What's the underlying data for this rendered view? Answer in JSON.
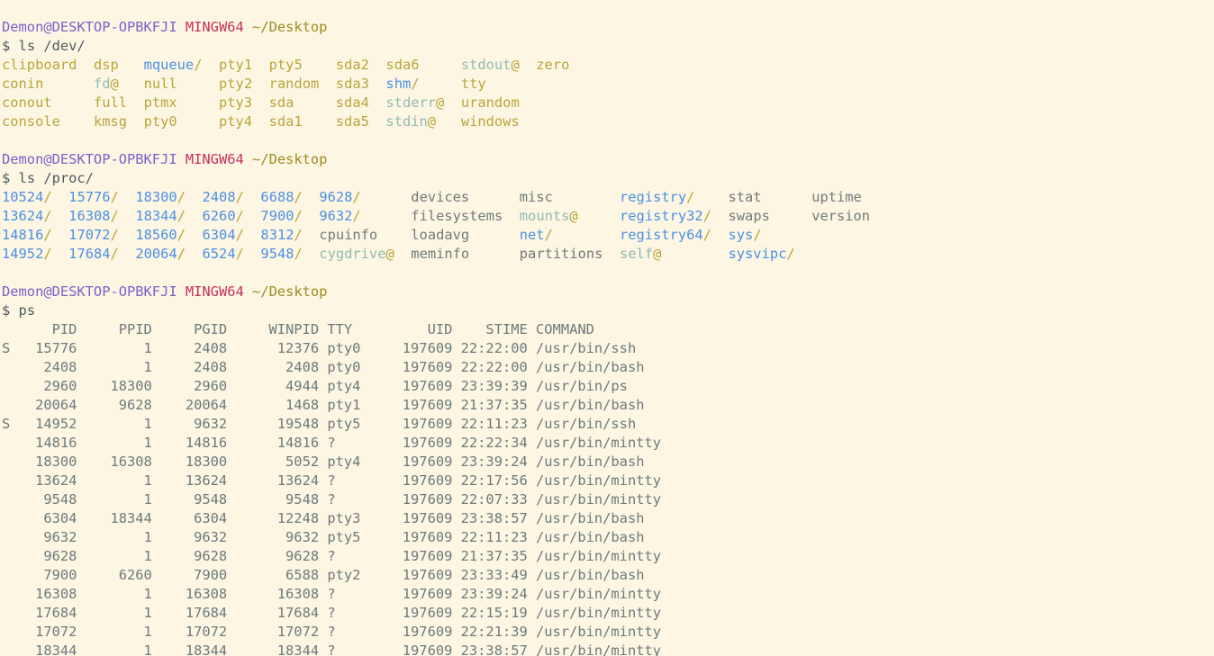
{
  "terminal": {
    "title": "MINGW64:/c/Users/Demon/Desktop",
    "shell": "MINGW64",
    "background_color": "#fdf6e3",
    "prompt": {
      "user_host": "Demon@DESKTOP-OPBKFJI",
      "env": "MINGW64",
      "cwd": "~/Desktop",
      "symbol": "$"
    },
    "colors": {
      "user_host": "#7d5fc9",
      "env": "#c7305c",
      "cwd": "#9c8c22",
      "command": "#4d5b60",
      "file": "#b9a53c",
      "directory": "#4d90e2",
      "symlink": "#92bab1",
      "plain": "#707a7a",
      "ps_output": "#6c7a7d"
    }
  },
  "blocks": [
    {
      "id": "ls-dev",
      "command": "ls /dev/",
      "rows": [
        [
          {
            "t": "clipboard",
            "k": "file"
          },
          {
            "t": "dsp",
            "k": "file"
          },
          {
            "t": "mqueue",
            "k": "dir"
          },
          {
            "t": "pty1",
            "k": "file"
          },
          {
            "t": "pty5",
            "k": "file"
          },
          {
            "t": "sda2",
            "k": "file"
          },
          {
            "t": "sda6",
            "k": "file"
          },
          {
            "t": "stdout",
            "k": "link"
          },
          {
            "t": "zero",
            "k": "file"
          }
        ],
        [
          {
            "t": "conin",
            "k": "file"
          },
          {
            "t": "fd",
            "k": "link"
          },
          {
            "t": "null",
            "k": "file"
          },
          {
            "t": "pty2",
            "k": "file"
          },
          {
            "t": "random",
            "k": "file"
          },
          {
            "t": "sda3",
            "k": "file"
          },
          {
            "t": "shm",
            "k": "dir"
          },
          {
            "t": "tty",
            "k": "file"
          }
        ],
        [
          {
            "t": "conout",
            "k": "file"
          },
          {
            "t": "full",
            "k": "file"
          },
          {
            "t": "ptmx",
            "k": "file"
          },
          {
            "t": "pty3",
            "k": "file"
          },
          {
            "t": "sda",
            "k": "file"
          },
          {
            "t": "sda4",
            "k": "file"
          },
          {
            "t": "stderr",
            "k": "link"
          },
          {
            "t": "urandom",
            "k": "file"
          }
        ],
        [
          {
            "t": "console",
            "k": "file"
          },
          {
            "t": "kmsg",
            "k": "file"
          },
          {
            "t": "pty0",
            "k": "file"
          },
          {
            "t": "pty4",
            "k": "file"
          },
          {
            "t": "sda1",
            "k": "file"
          },
          {
            "t": "sda5",
            "k": "file"
          },
          {
            "t": "stdin",
            "k": "link"
          },
          {
            "t": "windows",
            "k": "file"
          }
        ]
      ]
    },
    {
      "id": "ls-proc",
      "command": "ls /proc/",
      "rows": [
        [
          {
            "t": "10524",
            "k": "dir"
          },
          {
            "t": "15776",
            "k": "dir"
          },
          {
            "t": "18300",
            "k": "dir"
          },
          {
            "t": "2408",
            "k": "dir"
          },
          {
            "t": "6688",
            "k": "dir"
          },
          {
            "t": "9628",
            "k": "dir"
          },
          {
            "t": "devices",
            "k": "plain"
          },
          {
            "t": "misc",
            "k": "plain"
          },
          {
            "t": "registry",
            "k": "dir"
          },
          {
            "t": "stat",
            "k": "plain"
          },
          {
            "t": "uptime",
            "k": "plain"
          }
        ],
        [
          {
            "t": "13624",
            "k": "dir"
          },
          {
            "t": "16308",
            "k": "dir"
          },
          {
            "t": "18344",
            "k": "dir"
          },
          {
            "t": "6260",
            "k": "dir"
          },
          {
            "t": "7900",
            "k": "dir"
          },
          {
            "t": "9632",
            "k": "dir"
          },
          {
            "t": "filesystems",
            "k": "plain"
          },
          {
            "t": "mounts",
            "k": "link"
          },
          {
            "t": "registry32",
            "k": "dir"
          },
          {
            "t": "swaps",
            "k": "plain"
          },
          {
            "t": "version",
            "k": "plain"
          }
        ],
        [
          {
            "t": "14816",
            "k": "dir"
          },
          {
            "t": "17072",
            "k": "dir"
          },
          {
            "t": "18560",
            "k": "dir"
          },
          {
            "t": "6304",
            "k": "dir"
          },
          {
            "t": "8312",
            "k": "dir"
          },
          {
            "t": "cpuinfo",
            "k": "plain"
          },
          {
            "t": "loadavg",
            "k": "plain"
          },
          {
            "t": "net",
            "k": "dir"
          },
          {
            "t": "registry64",
            "k": "dir"
          },
          {
            "t": "sys",
            "k": "dir"
          }
        ],
        [
          {
            "t": "14952",
            "k": "dir"
          },
          {
            "t": "17684",
            "k": "dir"
          },
          {
            "t": "20064",
            "k": "dir"
          },
          {
            "t": "6524",
            "k": "dir"
          },
          {
            "t": "9548",
            "k": "dir"
          },
          {
            "t": "cygdrive",
            "k": "link"
          },
          {
            "t": "meminfo",
            "k": "plain"
          },
          {
            "t": "partitions",
            "k": "plain"
          },
          {
            "t": "self",
            "k": "link"
          },
          {
            "t": "sysvipc",
            "k": "dir"
          }
        ]
      ]
    },
    {
      "id": "ps",
      "command": "ps",
      "table": {
        "headers": [
          "",
          "PID",
          "PPID",
          "PGID",
          "WINPID",
          "TTY",
          "UID",
          "STIME",
          "COMMAND"
        ],
        "rows": [
          {
            "s": "S",
            "pid": "15776",
            "ppid": "1",
            "pgid": "2408",
            "winpid": "12376",
            "tty": "pty0",
            "uid": "197609",
            "stime": "22:22:00",
            "command": "/usr/bin/ssh"
          },
          {
            "s": "",
            "pid": "2408",
            "ppid": "1",
            "pgid": "2408",
            "winpid": "2408",
            "tty": "pty0",
            "uid": "197609",
            "stime": "22:22:00",
            "command": "/usr/bin/bash"
          },
          {
            "s": "",
            "pid": "2960",
            "ppid": "18300",
            "pgid": "2960",
            "winpid": "4944",
            "tty": "pty4",
            "uid": "197609",
            "stime": "23:39:39",
            "command": "/usr/bin/ps"
          },
          {
            "s": "",
            "pid": "20064",
            "ppid": "9628",
            "pgid": "20064",
            "winpid": "1468",
            "tty": "pty1",
            "uid": "197609",
            "stime": "21:37:35",
            "command": "/usr/bin/bash"
          },
          {
            "s": "S",
            "pid": "14952",
            "ppid": "1",
            "pgid": "9632",
            "winpid": "19548",
            "tty": "pty5",
            "uid": "197609",
            "stime": "22:11:23",
            "command": "/usr/bin/ssh"
          },
          {
            "s": "",
            "pid": "14816",
            "ppid": "1",
            "pgid": "14816",
            "winpid": "14816",
            "tty": "?",
            "uid": "197609",
            "stime": "22:22:34",
            "command": "/usr/bin/mintty"
          },
          {
            "s": "",
            "pid": "18300",
            "ppid": "16308",
            "pgid": "18300",
            "winpid": "5052",
            "tty": "pty4",
            "uid": "197609",
            "stime": "23:39:24",
            "command": "/usr/bin/bash"
          },
          {
            "s": "",
            "pid": "13624",
            "ppid": "1",
            "pgid": "13624",
            "winpid": "13624",
            "tty": "?",
            "uid": "197609",
            "stime": "22:17:56",
            "command": "/usr/bin/mintty"
          },
          {
            "s": "",
            "pid": "9548",
            "ppid": "1",
            "pgid": "9548",
            "winpid": "9548",
            "tty": "?",
            "uid": "197609",
            "stime": "22:07:33",
            "command": "/usr/bin/mintty"
          },
          {
            "s": "",
            "pid": "6304",
            "ppid": "18344",
            "pgid": "6304",
            "winpid": "12248",
            "tty": "pty3",
            "uid": "197609",
            "stime": "23:38:57",
            "command": "/usr/bin/bash"
          },
          {
            "s": "",
            "pid": "9632",
            "ppid": "1",
            "pgid": "9632",
            "winpid": "9632",
            "tty": "pty5",
            "uid": "197609",
            "stime": "22:11:23",
            "command": "/usr/bin/bash"
          },
          {
            "s": "",
            "pid": "9628",
            "ppid": "1",
            "pgid": "9628",
            "winpid": "9628",
            "tty": "?",
            "uid": "197609",
            "stime": "21:37:35",
            "command": "/usr/bin/mintty"
          },
          {
            "s": "",
            "pid": "7900",
            "ppid": "6260",
            "pgid": "7900",
            "winpid": "6588",
            "tty": "pty2",
            "uid": "197609",
            "stime": "23:33:49",
            "command": "/usr/bin/bash"
          },
          {
            "s": "",
            "pid": "16308",
            "ppid": "1",
            "pgid": "16308",
            "winpid": "16308",
            "tty": "?",
            "uid": "197609",
            "stime": "23:39:24",
            "command": "/usr/bin/mintty"
          },
          {
            "s": "",
            "pid": "17684",
            "ppid": "1",
            "pgid": "17684",
            "winpid": "17684",
            "tty": "?",
            "uid": "197609",
            "stime": "22:15:19",
            "command": "/usr/bin/mintty"
          },
          {
            "s": "",
            "pid": "17072",
            "ppid": "1",
            "pgid": "17072",
            "winpid": "17072",
            "tty": "?",
            "uid": "197609",
            "stime": "22:21:39",
            "command": "/usr/bin/mintty"
          },
          {
            "s": "",
            "pid": "18344",
            "ppid": "1",
            "pgid": "18344",
            "winpid": "18344",
            "tty": "?",
            "uid": "197609",
            "stime": "23:38:57",
            "command": "/usr/bin/mintty"
          }
        ]
      }
    }
  ]
}
